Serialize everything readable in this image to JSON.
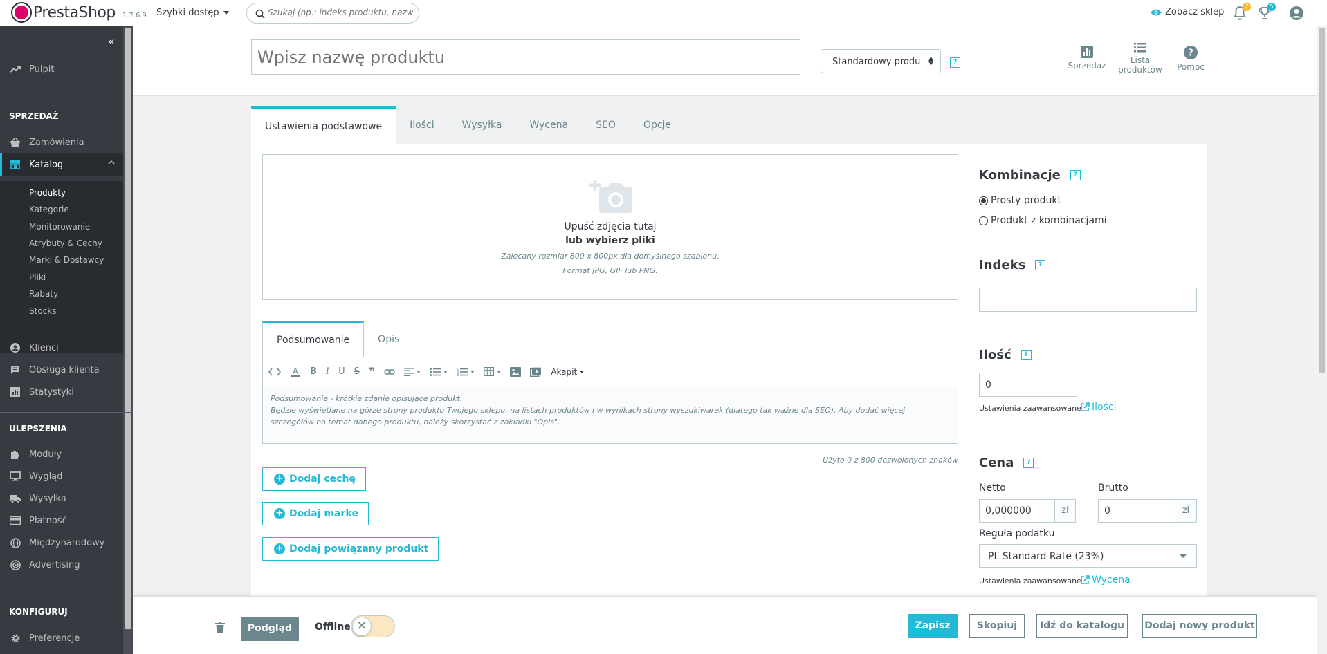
{
  "topbar": {
    "brand": "PrestaShop",
    "version": "1.7.6.9",
    "quick_access": "Szybki dostęp",
    "search_placeholder": "Szukaj (np.: indeks produktu, nazwa klie",
    "view_shop": "Zobacz sklep",
    "notifications_count": "7",
    "orders_count": "5"
  },
  "sidebar": {
    "dashboard": "Pulpit",
    "section_sell": "SPRZEDAŻ",
    "orders": "Zamówienia",
    "catalog": "Katalog",
    "catalog_sub": [
      "Produkty",
      "Kategorie",
      "Monitorowanie",
      "Atrybuty & Cechy",
      "Marki & Dostawcy",
      "Pliki",
      "Rabaty",
      "Stocks"
    ],
    "customers": "Klienci",
    "customer_service": "Obsługa klienta",
    "stats": "Statystyki",
    "section_improve": "ULEPSZENIA",
    "modules": "Moduły",
    "design": "Wygląd",
    "shipping": "Wysyłka",
    "payment": "Płatność",
    "international": "Międzynarodowy",
    "advertising": "Advertising",
    "section_configure": "KONFIGURUJ",
    "preferences": "Preferencje"
  },
  "header": {
    "name_placeholder": "Wpisz nazwę produktu",
    "product_type": "Standardowy produ",
    "help": "?",
    "tool_sales": "Sprzedaż",
    "tool_list_1": "Lista",
    "tool_list_2": "produktów",
    "tool_help": "Pomoc"
  },
  "tabs": [
    "Ustawienia podstawowe",
    "Ilości",
    "Wysyłka",
    "Wycena",
    "SEO",
    "Opcje"
  ],
  "dropzone": {
    "line1": "Upuść zdjęcia tutaj",
    "line2": "lub wybierz pliki",
    "line3": "Zalecany rozmiar 800 x 800px dla domyślnego szablonu.",
    "line4": "Format JPG, GIF lub PNG."
  },
  "editor": {
    "tab_summary": "Podsumowanie",
    "tab_description": "Opis",
    "format": "Akapit",
    "placeholder_1": "Podsumowanie - krótkie zdanie opisujące produkt.",
    "placeholder_2": "Będzie wyświetlane na górze strony produktu Twojego sklepu, na listach produktów i w wynikach strony wyszukiwarek (dlatego tak ważne dla SEO). Aby dodać więcej szczegółów na temat danego produktu, należy skorzystać z zakładki \"Opis\".",
    "char_count": "Użyto 0 z 800 dozwolonych znaków"
  },
  "buttons": {
    "add_feature": "Dodaj cechę",
    "add_brand": "Dodaj markę",
    "add_related": "Dodaj powiązany produkt"
  },
  "right": {
    "combinations_title": "Kombinacje",
    "simple_product": "Prosty produkt",
    "with_combinations": "Produkt z kombinacjami",
    "reference_title": "Indeks",
    "reference_value": "",
    "quantity_title": "Ilość",
    "quantity_value": "0",
    "advanced_settings": "Ustawienia zaawansowane",
    "quantities_link": "Ilości",
    "price_title": "Cena",
    "net_label": "Netto",
    "net_value": "0,000000",
    "currency": "zł",
    "gross_label": "Brutto",
    "gross_value": "0",
    "tax_rule_label": "Reguła podatku",
    "tax_rule_value": "PL Standard Rate (23%)",
    "pricing_link": "Wycena"
  },
  "footer": {
    "preview": "Podgląd",
    "offline": "Offline",
    "save": "Zapisz",
    "duplicate": "Skopiuj",
    "go_to_catalog": "Idź do katalogu",
    "add_new": "Dodaj nowy produkt"
  },
  "colors": {
    "accent": "#25b9d7",
    "sidebar": "#363a41",
    "brand": "#df0067"
  }
}
